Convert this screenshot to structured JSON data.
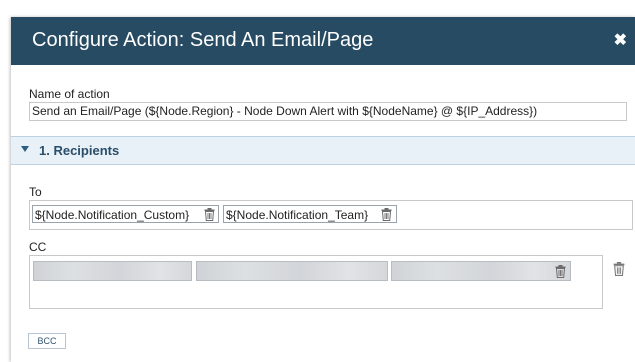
{
  "dialog": {
    "title": "Configure Action: Send An Email/Page",
    "close_icon": "close-icon"
  },
  "name_of_action": {
    "label": "Name of action",
    "value": "Send an Email/Page (${Node.Region} - Node Down Alert with ${NodeName} @ ${IP_Address})"
  },
  "section": {
    "title": "1. Recipients",
    "expanded": true
  },
  "to": {
    "label": "To",
    "recipients": [
      "${Node.Notification_Custom}",
      "${Node.Notification_Team}"
    ]
  },
  "cc": {
    "label": "CC",
    "recipients_blurred_count": 3
  },
  "bcc": {
    "label": "BCC"
  },
  "colors": {
    "title_bar": "#264b63",
    "section_header": "#e8f1f8",
    "section_text": "#2a4d69"
  }
}
